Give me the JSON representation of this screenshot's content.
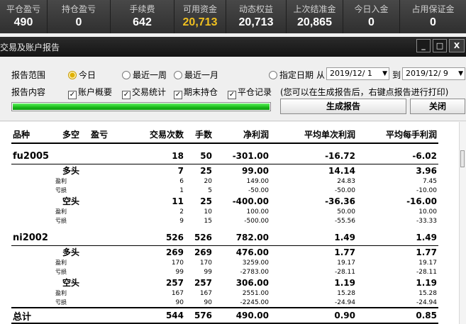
{
  "metrics": [
    {
      "label": "平仓盈亏",
      "value": "490"
    },
    {
      "label": "持仓盈亏",
      "value": "0"
    },
    {
      "label": "手续费",
      "value": "642"
    },
    {
      "label": "可用资金",
      "value": "20,713"
    },
    {
      "label": "动态权益",
      "value": "20,713"
    },
    {
      "label": "上次结准金",
      "value": "20,865"
    },
    {
      "label": "今日入金",
      "value": "0"
    },
    {
      "label": "占用保证金",
      "value": "0"
    }
  ],
  "window": {
    "title": "交易及账户报告",
    "buttons": {
      "minimize": "_",
      "restore": "□",
      "close": "X"
    }
  },
  "options": {
    "range_label": "报告范围",
    "ranges": [
      "今日",
      "最近一周",
      "最近一月"
    ],
    "selected_range": "今日",
    "custom_date_label": "指定日期",
    "from_label": "从",
    "from_date": "2019/12/ 1",
    "to_label": "到",
    "to_date": "2019/12/ 9",
    "content_label": "报告内容",
    "contents": [
      "账户概要",
      "交易统计",
      "期末持仓",
      "平仓记录"
    ],
    "hint": "(您可以在生成报告后，右键点报告进行打印)",
    "progress": 1.0,
    "generate_button": "生成报告",
    "close_button": "关闭"
  },
  "report": {
    "headers": [
      "品种",
      "多空",
      "盈亏",
      "交易次数",
      "手数",
      "净利润",
      "平均单次利润",
      "平均每手利润"
    ],
    "products": [
      {
        "name": "fu2005",
        "trades": "18",
        "lots": "50",
        "net": "-301.00",
        "avg_trade": "-16.72",
        "avg_lot": "-6.02",
        "sides": [
          {
            "name": "多头",
            "trades": "7",
            "lots": "25",
            "net": "99.00",
            "avg_trade": "14.14",
            "avg_lot": "3.96",
            "details": [
              {
                "name": "盈利",
                "trades": "6",
                "lots": "20",
                "net": "149.00",
                "avg_trade": "24.83",
                "avg_lot": "7.45"
              },
              {
                "name": "亏损",
                "trades": "1",
                "lots": "5",
                "net": "-50.00",
                "avg_trade": "-50.00",
                "avg_lot": "-10.00"
              }
            ]
          },
          {
            "name": "空头",
            "trades": "11",
            "lots": "25",
            "net": "-400.00",
            "avg_trade": "-36.36",
            "avg_lot": "-16.00",
            "details": [
              {
                "name": "盈利",
                "trades": "2",
                "lots": "10",
                "net": "100.00",
                "avg_trade": "50.00",
                "avg_lot": "10.00"
              },
              {
                "name": "亏损",
                "trades": "9",
                "lots": "15",
                "net": "-500.00",
                "avg_trade": "-55.56",
                "avg_lot": "-33.33"
              }
            ]
          }
        ]
      },
      {
        "name": "ni2002",
        "trades": "526",
        "lots": "526",
        "net": "782.00",
        "avg_trade": "1.49",
        "avg_lot": "1.49",
        "sides": [
          {
            "name": "多头",
            "trades": "269",
            "lots": "269",
            "net": "476.00",
            "avg_trade": "1.77",
            "avg_lot": "1.77",
            "details": [
              {
                "name": "盈利",
                "trades": "170",
                "lots": "170",
                "net": "3259.00",
                "avg_trade": "19.17",
                "avg_lot": "19.17"
              },
              {
                "name": "亏损",
                "trades": "99",
                "lots": "99",
                "net": "-2783.00",
                "avg_trade": "-28.11",
                "avg_lot": "-28.11"
              }
            ]
          },
          {
            "name": "空头",
            "trades": "257",
            "lots": "257",
            "net": "306.00",
            "avg_trade": "1.19",
            "avg_lot": "1.19",
            "details": [
              {
                "name": "盈利",
                "trades": "167",
                "lots": "167",
                "net": "2551.00",
                "avg_trade": "15.28",
                "avg_lot": "15.28"
              },
              {
                "name": "亏损",
                "trades": "90",
                "lots": "90",
                "net": "-2245.00",
                "avg_trade": "-24.94",
                "avg_lot": "-24.94"
              }
            ]
          }
        ]
      }
    ],
    "total": {
      "name": "总计",
      "trades": "544",
      "lots": "576",
      "net": "490.00",
      "avg_trade": "0.90",
      "avg_lot": "0.85"
    }
  },
  "colors": {
    "highlight": "#f0c020",
    "progress": "#18b818",
    "bar_bg": "#3a3a3a"
  }
}
